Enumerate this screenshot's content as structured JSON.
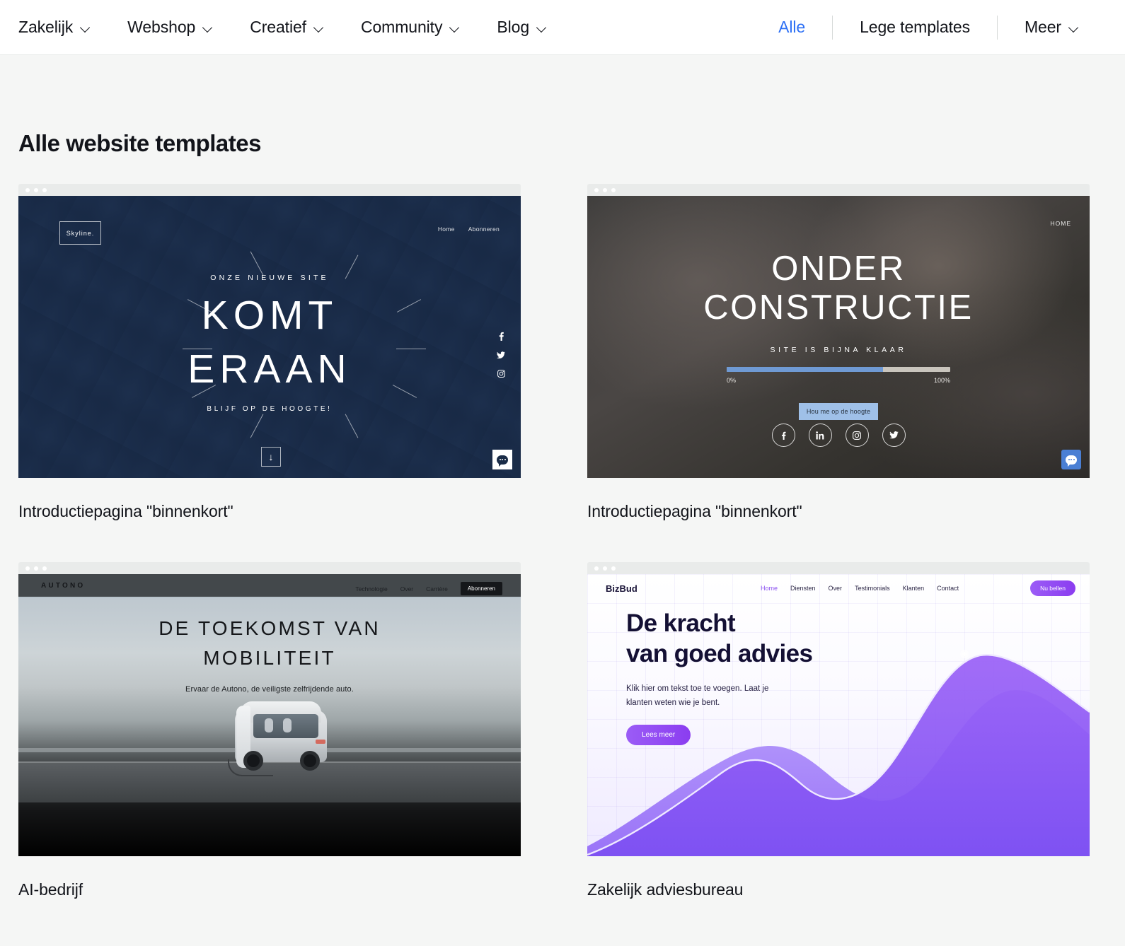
{
  "nav": {
    "left_items": [
      {
        "label": "Zakelijk",
        "icon": "chevron-down-icon"
      },
      {
        "label": "Webshop",
        "icon": "chevron-down-icon"
      },
      {
        "label": "Creatief",
        "icon": "chevron-down-icon"
      },
      {
        "label": "Community",
        "icon": "chevron-down-icon"
      },
      {
        "label": "Blog",
        "icon": "chevron-down-icon"
      }
    ],
    "right_items": [
      {
        "label": "Alle",
        "active": true
      },
      {
        "label": "Lege templates",
        "active": false
      },
      {
        "label": "Meer",
        "active": false,
        "icon": "chevron-down-icon"
      }
    ],
    "active_color": "#2d70f5"
  },
  "page": {
    "title": "Alle website templates"
  },
  "cards": [
    {
      "caption": "Introductiepagina \"binnenkort\"",
      "preview": {
        "logo": "Skyline.",
        "nav": [
          "Home",
          "Abonneren"
        ],
        "kicker": "ONZE NIEUWE SITE",
        "headline_line1": "KOMT",
        "headline_line2": "ERAAN",
        "subline": "BLIJF OP DE HOOGTE!",
        "social": [
          "facebook-icon",
          "twitter-icon",
          "instagram-icon"
        ],
        "scroll_arrow": "↓",
        "chat_widget": "chat-icon"
      }
    },
    {
      "caption": "Introductiepagina \"binnenkort\"",
      "preview": {
        "nav": [
          "HOME"
        ],
        "headline_line1": "ONDER",
        "headline_line2": "CONSTRUCTIE",
        "subline": "SITE IS BIJNA KLAAR",
        "progress_percent": 70,
        "progress_min_label": "0%",
        "progress_max_label": "100%",
        "button": "Hou me op de hoogte",
        "social": [
          "facebook-icon",
          "linkedin-icon",
          "instagram-icon",
          "twitter-icon"
        ],
        "chat_widget": "chat-icon",
        "accent": "#6f9ad4"
      }
    },
    {
      "caption": "AI-bedrijf",
      "preview": {
        "logo": "AUTONO",
        "nav": [
          "Technologie",
          "Over",
          "Carrière"
        ],
        "nav_button": "Abonneren",
        "headline_line1": "DE TOEKOMST VAN",
        "headline_line2": "MOBILITEIT",
        "subline": "Ervaar de Autono, de veiligste zelfrijdende auto."
      }
    },
    {
      "caption": "Zakelijk adviesbureau",
      "preview": {
        "logo": "BizBud",
        "nav": [
          "Home",
          "Diensten",
          "Over",
          "Testimonials",
          "Klanten",
          "Contact"
        ],
        "nav_active": "Home",
        "nav_button": "Nu bellen",
        "headline_line1": "De kracht",
        "headline_line2": "van goed advies",
        "body_line1": "Klik hier om tekst toe te voegen. Laat je",
        "body_line2": "klanten weten wie je bent.",
        "button": "Lees meer",
        "accent": "#8b3df0"
      }
    }
  ]
}
